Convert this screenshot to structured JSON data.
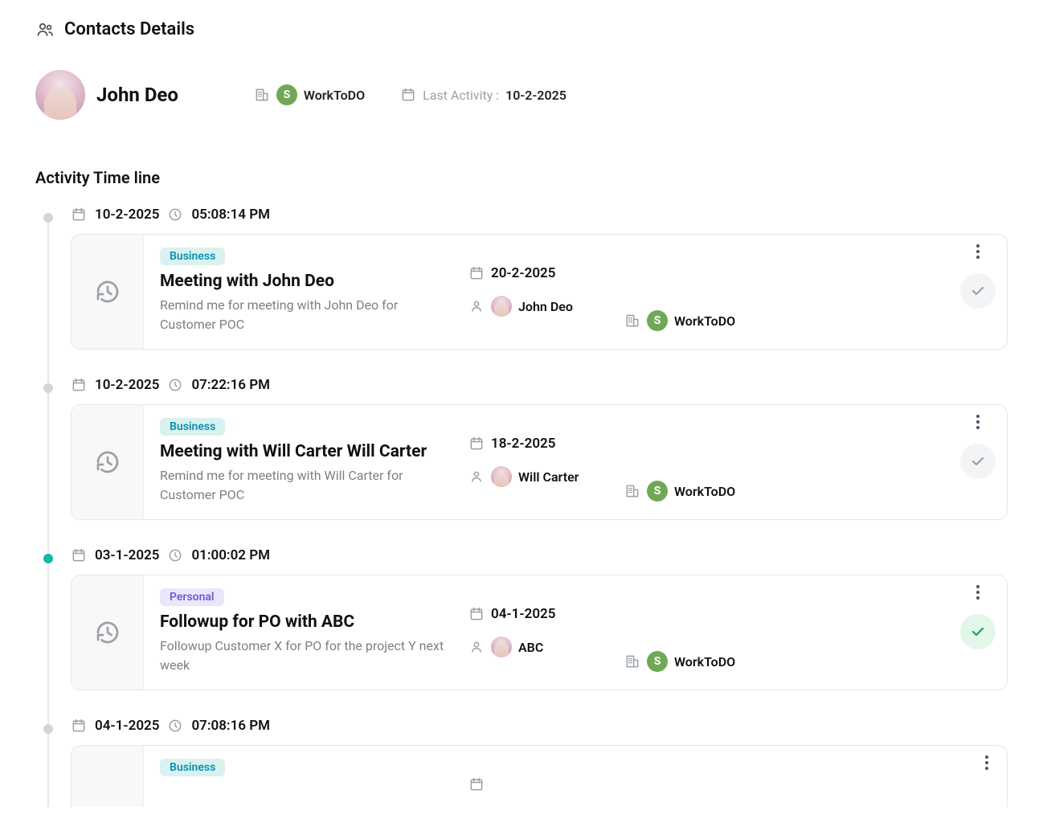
{
  "header": {
    "title": "Contacts Details"
  },
  "contact": {
    "name": "John Deo",
    "workspace": "WorkToDO",
    "workspace_initial": "S",
    "last_activity_label": "Last Activity :",
    "last_activity_date": "10-2-2025"
  },
  "section_title": "Activity Time line",
  "timeline": [
    {
      "active": false,
      "date": "10-2-2025",
      "time": "05:08:14 PM",
      "tag": {
        "label": "Business",
        "kind": "business"
      },
      "title": "Meeting with  John Deo",
      "desc": "Remind me for meeting with John Deo for Customer POC",
      "due_date": "20-2-2025",
      "person": "John Deo",
      "workspace": "WorkToDO",
      "workspace_initial": "S",
      "completed": false
    },
    {
      "active": false,
      "date": "10-2-2025",
      "time": "07:22:16 PM",
      "tag": {
        "label": "Business",
        "kind": "business"
      },
      "title": "Meeting with Will Carter  Will Carter",
      "desc": "Remind me for meeting with Will Carter for Customer POC",
      "due_date": "18-2-2025",
      "person": "Will Carter",
      "workspace": "WorkToDO",
      "workspace_initial": "S",
      "completed": false
    },
    {
      "active": true,
      "date": "03-1-2025",
      "time": "01:00:02 PM",
      "tag": {
        "label": "Personal",
        "kind": "personal"
      },
      "title": "Followup for PO with  ABC",
      "desc": "Followup Customer X for PO for the project Y next week",
      "due_date": "04-1-2025",
      "person": "ABC",
      "workspace": "WorkToDO",
      "workspace_initial": "S",
      "completed": true
    },
    {
      "active": false,
      "date": "04-1-2025",
      "time": "07:08:16 PM",
      "tag": {
        "label": "Business",
        "kind": "business"
      },
      "title": "",
      "desc": "",
      "due_date": "",
      "person": "",
      "workspace": "",
      "workspace_initial": "",
      "completed": false
    }
  ]
}
